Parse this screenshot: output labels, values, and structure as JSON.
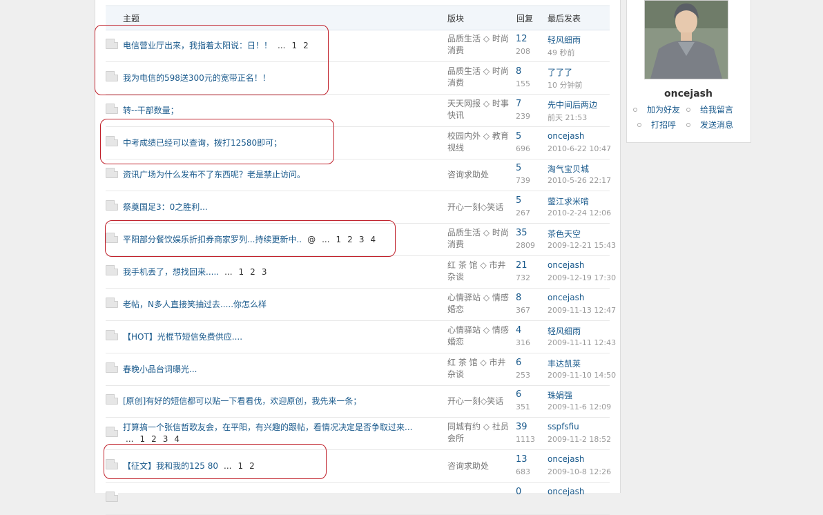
{
  "table": {
    "headers": {
      "topic": "主题",
      "board": "版块",
      "replies": "回复",
      "last_post": "最后发表"
    },
    "rows": [
      {
        "title": "电信营业厅出来，我指着太阳说：日！！",
        "pages": [
          "...",
          "1",
          "2"
        ],
        "board": "品质生活 ◇ 时尚消费",
        "replies": "12",
        "views": "208",
        "last_user": "轻风细雨",
        "last_time": "49 秒前"
      },
      {
        "title": "我为电信的598送300元的宽带正名！！",
        "pages": [],
        "board": "品质生活 ◇ 时尚消费",
        "replies": "8",
        "views": "155",
        "last_user": "了了了",
        "last_time": "10 分钟前"
      },
      {
        "title": "转--干部数量；",
        "pages": [],
        "board": "天天网报 ◇ 时事快讯",
        "replies": "7",
        "views": "239",
        "last_user": "先中间后两边",
        "last_time": "前天 21:53"
      },
      {
        "title": "中考成绩已经可以查询，拨打12580即可；",
        "pages": [],
        "board": "校园内外 ◇ 教育视线",
        "replies": "5",
        "views": "696",
        "last_user": "oncejash",
        "last_time": "2010-6-22 10:47"
      },
      {
        "title": "资讯广场为什么发布不了东西呢？老是禁止访问。",
        "pages": [],
        "board": "咨询求助处",
        "replies": "5",
        "views": "739",
        "last_user": "淘气宝贝城",
        "last_time": "2010-5-26 22:17"
      },
      {
        "title": "祭奠国足3：0之胜利...",
        "pages": [],
        "board": "开心一刻◇笑话",
        "replies": "5",
        "views": "267",
        "last_user": "蓥江求米啃",
        "last_time": "2010-2-24 12:06"
      },
      {
        "title": "平阳部分餐饮娱乐折扣券商家罗列...持续更新中..",
        "pages": [
          "@",
          "...",
          "1",
          "2",
          "3",
          "4"
        ],
        "board": "品质生活 ◇ 时尚消费",
        "replies": "35",
        "views": "2809",
        "last_user": "茶色天空",
        "last_time": "2009-12-21 15:43"
      },
      {
        "title": "我手机丢了，想找回来.....",
        "pages": [
          "...",
          "1",
          "2",
          "3"
        ],
        "board": "红 茶 馆 ◇ 市井杂谈",
        "replies": "21",
        "views": "732",
        "last_user": "oncejash",
        "last_time": "2009-12-19 17:30"
      },
      {
        "title": "老帖，N多人直接笑抽过去.....你怎么样",
        "pages": [],
        "board": "心情驿站 ◇ 情感婚恋",
        "replies": "8",
        "views": "367",
        "last_user": "oncejash",
        "last_time": "2009-11-13 12:47"
      },
      {
        "title": "【HOT】光棍节短信免费供应....",
        "pages": [],
        "board": "心情驿站 ◇ 情感婚恋",
        "replies": "4",
        "views": "316",
        "last_user": "轻风细雨",
        "last_time": "2009-11-11 12:43"
      },
      {
        "title": "春晚小品台词曝光...",
        "pages": [],
        "board": "红 茶 馆 ◇ 市井杂谈",
        "replies": "6",
        "views": "253",
        "last_user": "丰达凯莱",
        "last_time": "2009-11-10 14:50"
      },
      {
        "title": "[原创]有好的短信都可以贴一下看看伐，欢迎原创，我先来一条；",
        "pages": [],
        "board": "开心一刻◇笑话",
        "replies": "6",
        "views": "351",
        "last_user": "珠娟强",
        "last_time": "2009-11-6 12:09"
      },
      {
        "title": "打算搞一个张信哲歌友会，在平阳，有兴趣的跟帖，看情况决定是否争取过来...",
        "pages": [
          "...",
          "1",
          "2",
          "3",
          "4"
        ],
        "board": "同城有约 ◇ 社员会所",
        "replies": "39",
        "views": "1113",
        "last_user": "sspfsfiu",
        "last_time": "2009-11-2 18:52"
      },
      {
        "title": "【征文】我和我的125 80",
        "pages": [
          "...",
          "1",
          "2"
        ],
        "board": "咨询求助处",
        "replies": "13",
        "views": "683",
        "last_user": "oncejash",
        "last_time": "2009-10-8 12:26"
      },
      {
        "title": "",
        "pages": [],
        "board": "",
        "replies": "0",
        "views": "",
        "last_user": "oncejash",
        "last_time": ""
      }
    ]
  },
  "profile": {
    "username": "oncejash",
    "actions": [
      "加为好友",
      "给我留言",
      "打招呼",
      "发送消息"
    ]
  },
  "colors": {
    "link": "#1a5a8c",
    "highlight": "#c0202a"
  }
}
